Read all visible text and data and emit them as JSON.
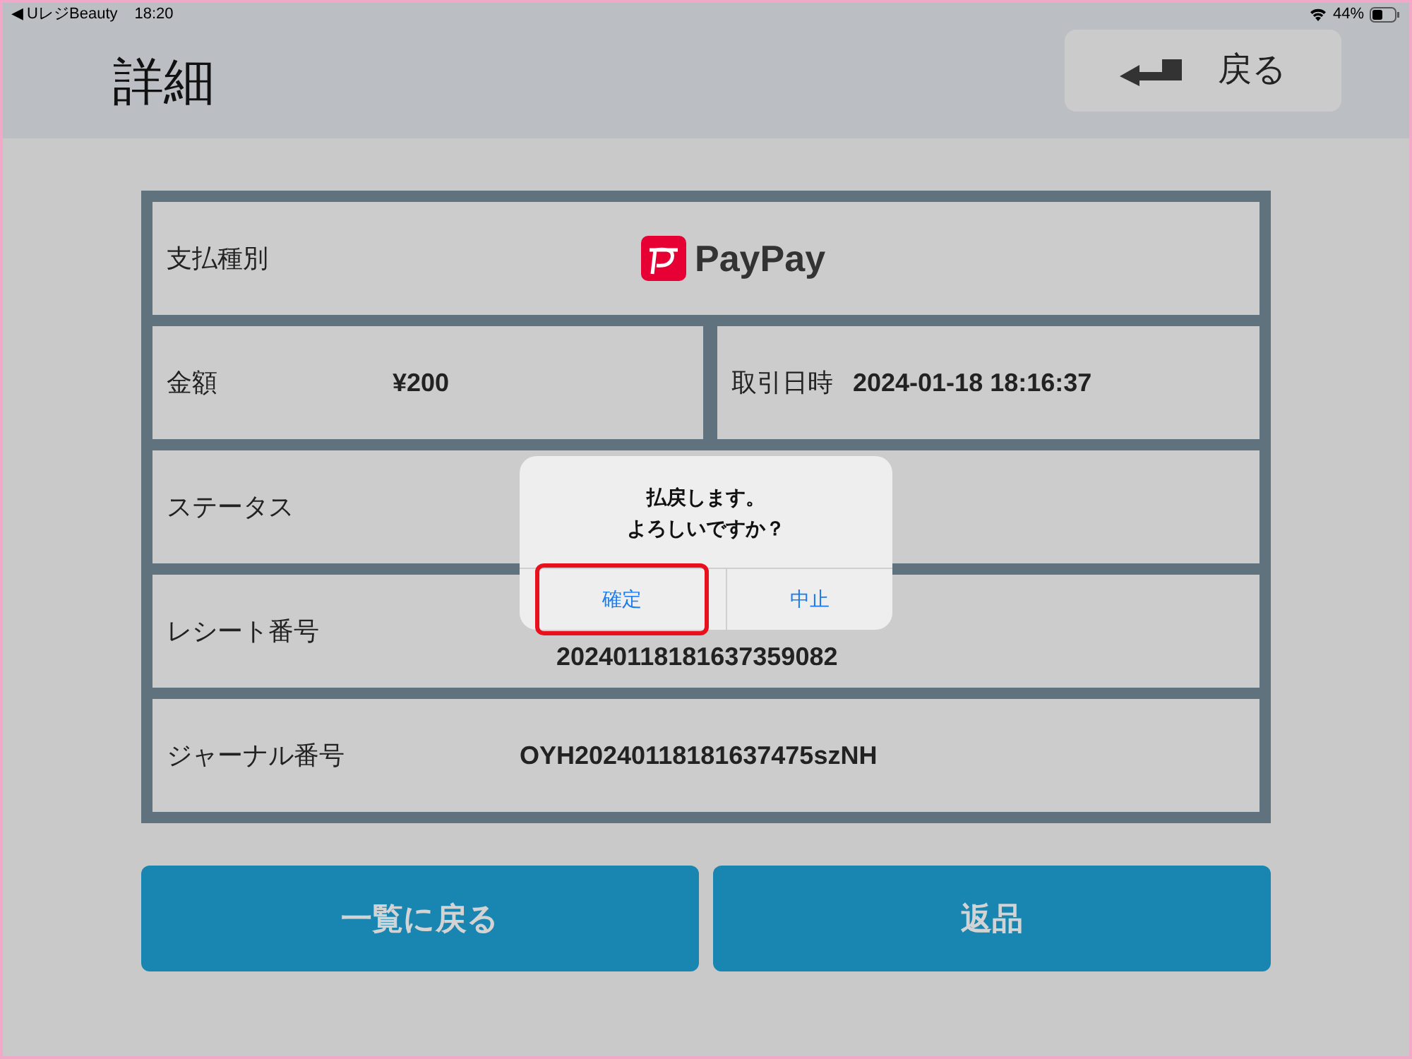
{
  "status_bar": {
    "back_app": "◀ UレジBeauty",
    "time": "18:20",
    "battery_percent": "44%"
  },
  "header": {
    "title": "詳細",
    "back_button": "戻る"
  },
  "details": {
    "payment_type": {
      "label": "支払種別",
      "brand": "PayPay"
    },
    "amount": {
      "label": "金額",
      "value": "¥200"
    },
    "datetime": {
      "label": "取引日時",
      "value": "2024-01-18 18:16:37"
    },
    "rows": [
      {
        "label": "ステータス"
      },
      {
        "label": "レシート番号",
        "value": "20240118181637359082"
      },
      {
        "label": "ジャーナル番号",
        "value": "OYH20240118181637475szNH"
      }
    ]
  },
  "buttons": [
    "一覧に戻る",
    "返品"
  ],
  "dialog": {
    "message": [
      "払戻します。",
      "よろしいですか？"
    ],
    "actions": [
      {
        "label": "確定",
        "highlighted": true
      },
      {
        "label": "中止",
        "highlighted": false
      }
    ]
  }
}
